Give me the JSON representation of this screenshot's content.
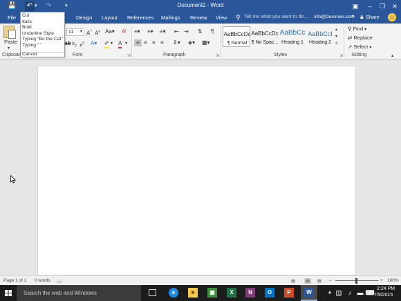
{
  "titlebar": {
    "title": "Document2 - Word",
    "save_icon": "save-icon",
    "undo_icon": "undo-icon",
    "redo_icon": "redo-icon",
    "customize_icon": "customize-icon"
  },
  "tabs": {
    "file": "File",
    "design": "Design",
    "layout": "Layout",
    "references": "References",
    "mailings": "Mailings",
    "review": "Review",
    "view": "View",
    "tell_me": "Tell me what you want to do...",
    "account": "info@Dummies.com",
    "share": "Share"
  },
  "ribbon": {
    "clipboard": {
      "paste": "Paste",
      "label": "Clipboard"
    },
    "font": {
      "size": "11",
      "label": "Font",
      "case": "Aa"
    },
    "paragraph": {
      "label": "Paragraph"
    },
    "styles": {
      "label": "Styles",
      "items": [
        {
          "sample": "AaBbCcDc",
          "name": "¶ Normal"
        },
        {
          "sample": "AaBbCcDc",
          "name": "¶ No Spac..."
        },
        {
          "sample": "AaBbCc",
          "name": "Heading 1"
        },
        {
          "sample": "AaBbCcI",
          "name": "Heading 2"
        }
      ]
    },
    "editing": {
      "find": "Find",
      "replace": "Replace",
      "select": "Select",
      "label": "Editing"
    }
  },
  "undo_menu": {
    "items": [
      "Cut",
      "Italic",
      "Bold",
      "Underline Style",
      "Typing \"Bo the Cat\"",
      "Typing \" \""
    ],
    "cancel": "Cancel"
  },
  "statusbar": {
    "page": "Page 1 of 1",
    "words": "0 words",
    "zoom": "100%"
  },
  "taskbar": {
    "search_placeholder": "Search the web and Windows",
    "time": "2:24 PM",
    "date": "7/9/2015"
  },
  "colors": {
    "word_blue": "#2b579a",
    "taskbar": "#1c1c1c"
  }
}
